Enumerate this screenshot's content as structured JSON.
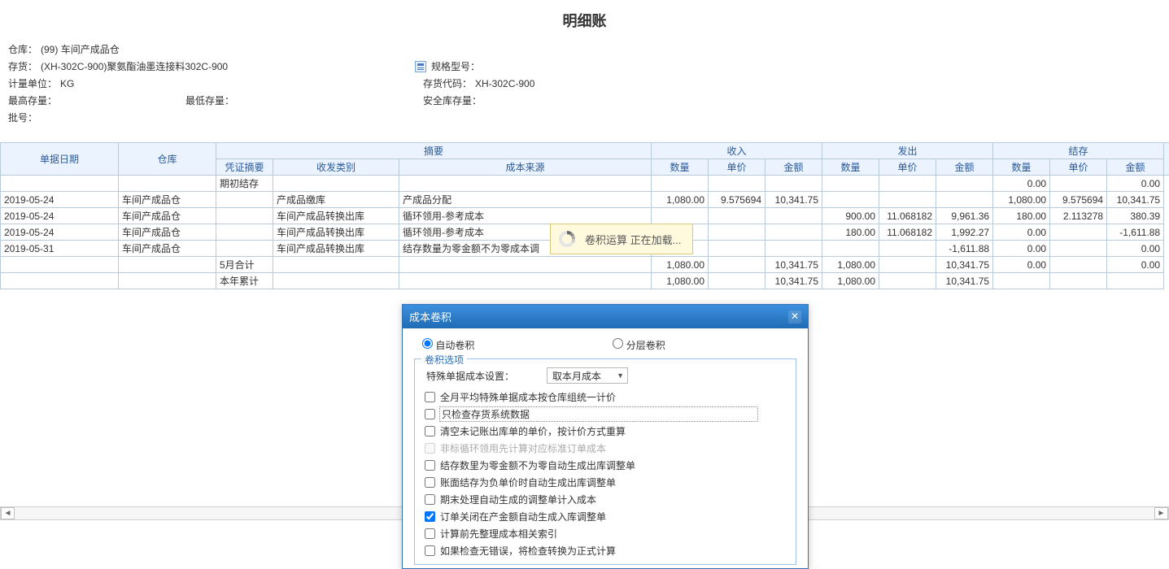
{
  "page": {
    "title": "明细账"
  },
  "info": {
    "warehouse_label": "仓库：",
    "warehouse_value": "(99) 车间产成品仓",
    "stock_label": "存货：",
    "stock_value": "(XH-302C-900)聚氨酯油墨连接料302C-900",
    "spec_label": "规格型号：",
    "spec_value": "",
    "unit_label": "计量单位：",
    "unit_value": "KG",
    "stockcode_label": "存货代码：",
    "stockcode_value": "XH-302C-900",
    "max_label": "最高存量：",
    "min_label": "最低存量：",
    "safe_label": "安全库存量：",
    "batch_label": "批号："
  },
  "headers": {
    "date": "单据日期",
    "warehouse": "仓库",
    "voucher": "凭证摘要",
    "summaryGroup": "摘要",
    "sendrecv": "收发类别",
    "costsrc": "成本来源",
    "inGroup": "收入",
    "outGroup": "发出",
    "balGroup": "结存",
    "qty": "数量",
    "price": "单价",
    "amount": "金额"
  },
  "rows": [
    {
      "date": "",
      "wh": "",
      "vch": "期初结存",
      "srt": "",
      "src": "",
      "in_q": "",
      "in_p": "",
      "in_a": "",
      "out_q": "",
      "out_p": "",
      "out_a": "",
      "bal_q": "0.00",
      "bal_p": "",
      "bal_a": "0.00"
    },
    {
      "date": "2019-05-24",
      "wh": "车间产成品仓",
      "vch": "",
      "srt": "产成品缴库",
      "src": "产成品分配",
      "in_q": "1,080.00",
      "in_p": "9.575694",
      "in_a": "10,341.75",
      "out_q": "",
      "out_p": "",
      "out_a": "",
      "bal_q": "1,080.00",
      "bal_p": "9.575694",
      "bal_a": "10,341.75"
    },
    {
      "date": "2019-05-24",
      "wh": "车间产成品仓",
      "vch": "",
      "srt": "车间产成品转换出库",
      "src": "循环领用-参考成本",
      "in_q": "",
      "in_p": "",
      "in_a": "",
      "out_q": "900.00",
      "out_p": "11.068182",
      "out_a": "9,961.36",
      "bal_q": "180.00",
      "bal_p": "2.113278",
      "bal_a": "380.39"
    },
    {
      "date": "2019-05-24",
      "wh": "车间产成品仓",
      "vch": "",
      "srt": "车间产成品转换出库",
      "src": "循环领用-参考成本",
      "in_q": "",
      "in_p": "",
      "in_a": "",
      "out_q": "180.00",
      "out_p": "11.068182",
      "out_a": "1,992.27",
      "bal_q": "0.00",
      "bal_p": "",
      "bal_a": "-1,611.88"
    },
    {
      "date": "2019-05-31",
      "wh": "车间产成品仓",
      "vch": "",
      "srt": "车间产成品转换出库",
      "src": "结存数量为零金额不为零成本调",
      "in_q": "",
      "in_p": "",
      "in_a": "",
      "out_q": "",
      "out_p": "",
      "out_a": "-1,611.88",
      "bal_q": "0.00",
      "bal_p": "",
      "bal_a": "0.00",
      "sel": true
    },
    {
      "date": "",
      "wh": "",
      "vch": "5月合计",
      "srt": "",
      "src": "",
      "in_q": "1,080.00",
      "in_p": "",
      "in_a": "10,341.75",
      "out_q": "1,080.00",
      "out_p": "",
      "out_a": "10,341.75",
      "bal_q": "0.00",
      "bal_p": "",
      "bal_a": "0.00"
    },
    {
      "date": "",
      "wh": "",
      "vch": "本年累计",
      "srt": "",
      "src": "",
      "in_q": "1,080.00",
      "in_p": "",
      "in_a": "10,341.75",
      "out_q": "1,080.00",
      "out_p": "",
      "out_a": "10,341.75",
      "bal_q": "",
      "bal_p": "",
      "bal_a": ""
    }
  ],
  "toast": {
    "text": "卷积运算  正在加载..."
  },
  "dialog": {
    "title": "成本卷积",
    "radio_auto": "自动卷积",
    "radio_layer": "分层卷积",
    "fieldset_title": "卷积选项",
    "special_label": "特殊单据成本设置：",
    "special_value": "取本月成本",
    "opts": [
      {
        "label": "全月平均特殊单据成本按仓库组统一计价",
        "checked": false,
        "disabled": false
      },
      {
        "label": "只检查存货系统数据",
        "checked": false,
        "disabled": false,
        "focus": true
      },
      {
        "label": "清空未记账出库单的单价，按计价方式重算",
        "checked": false,
        "disabled": false
      },
      {
        "label": "非标循环领用先计算对应标准订单成本",
        "checked": false,
        "disabled": true
      },
      {
        "label": "结存数里为零金额不为零自动生成出库调整单",
        "checked": false,
        "disabled": false
      },
      {
        "label": "账面结存为负单价时自动生成出库调整单",
        "checked": false,
        "disabled": false
      },
      {
        "label": "期末处理自动生成的调整单计入成本",
        "checked": false,
        "disabled": false
      },
      {
        "label": "订单关闭在产金额自动生成入库调整单",
        "checked": true,
        "disabled": false
      },
      {
        "label": "计算前先整理成本相关索引",
        "checked": false,
        "disabled": false
      },
      {
        "label": "如果检查无错误，将检查转换为正式计算",
        "checked": false,
        "disabled": false
      }
    ]
  }
}
